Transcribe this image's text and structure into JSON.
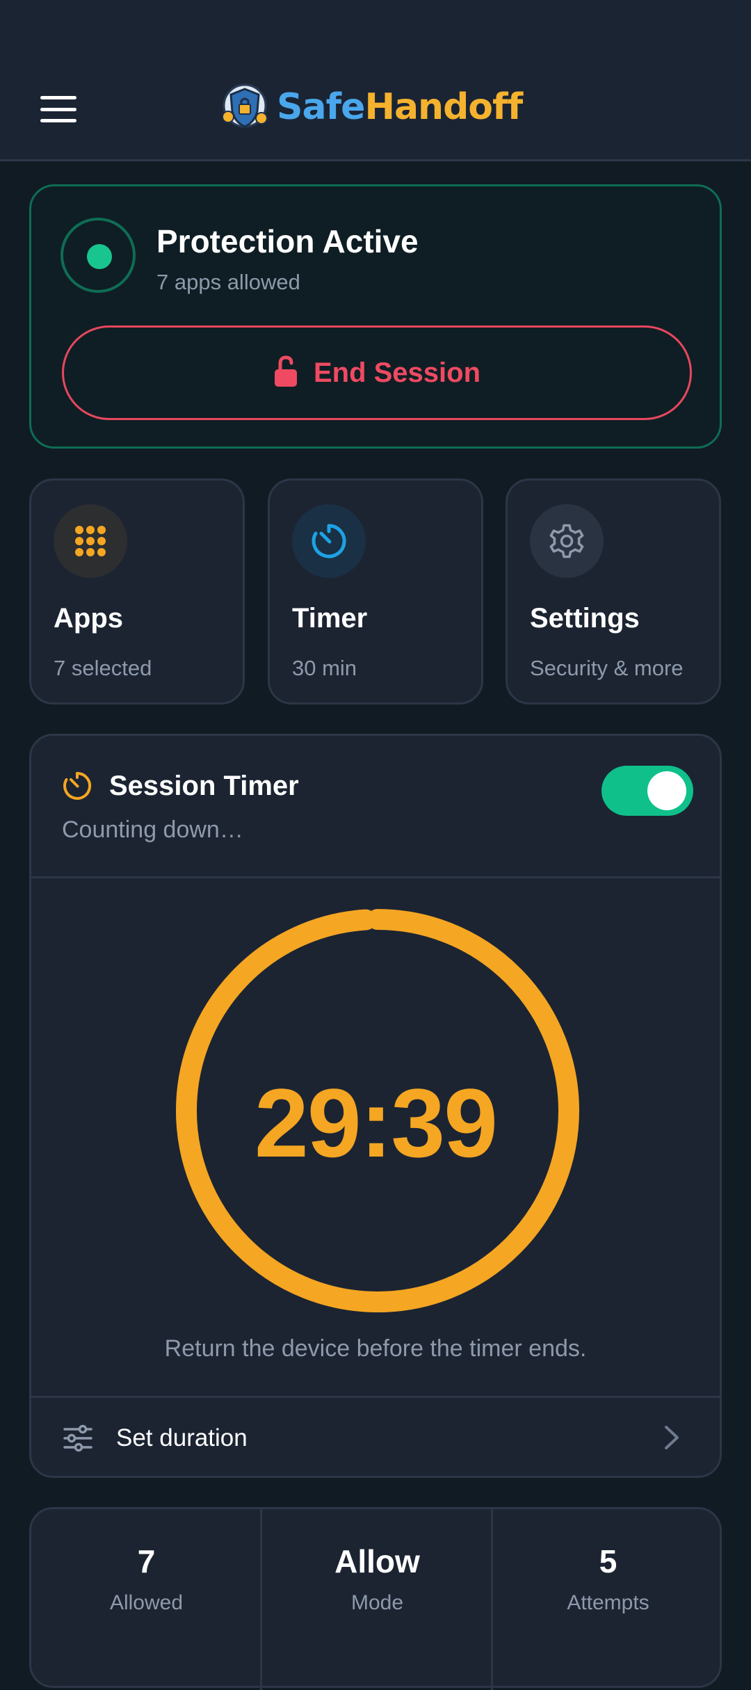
{
  "header": {
    "menu_icon": "hamburger-menu-icon",
    "logo_icon": "shield-lock-mascot-icon",
    "brand_part1": "Safe",
    "brand_part2": "Handoff"
  },
  "protection": {
    "title": "Protection Active",
    "subtitle": "7 apps allowed",
    "status_color": "#19c58f",
    "end_button_label": "End Session",
    "end_button_icon": "unlocked-padlock-icon"
  },
  "tiles": [
    {
      "icon": "grid-dots-icon",
      "title": "Apps",
      "subtitle": "7 selected"
    },
    {
      "icon": "timer-icon",
      "title": "Timer",
      "subtitle": "30 min"
    },
    {
      "icon": "gear-icon",
      "title": "Settings",
      "subtitle": "Security & more"
    }
  ],
  "session_timer": {
    "icon": "timer-icon",
    "title": "Session Timer",
    "subtitle": "Counting down…",
    "toggle_on": true,
    "countdown": "29:39",
    "progress_remaining": 0.99,
    "hint": "Return the device before the timer ends.",
    "set_duration_icon": "sliders-icon",
    "set_duration_label": "Set duration",
    "chevron_icon": "chevron-right-icon"
  },
  "stats": [
    {
      "value": "7",
      "label": "Allowed"
    },
    {
      "value": "Allow",
      "label": "Mode"
    },
    {
      "value": "5",
      "label": "Attempts"
    }
  ],
  "colors": {
    "accent_green": "#0fc08b",
    "accent_red": "#ef4a62",
    "accent_amber": "#f5a622",
    "accent_blue": "#1ea2e4"
  }
}
